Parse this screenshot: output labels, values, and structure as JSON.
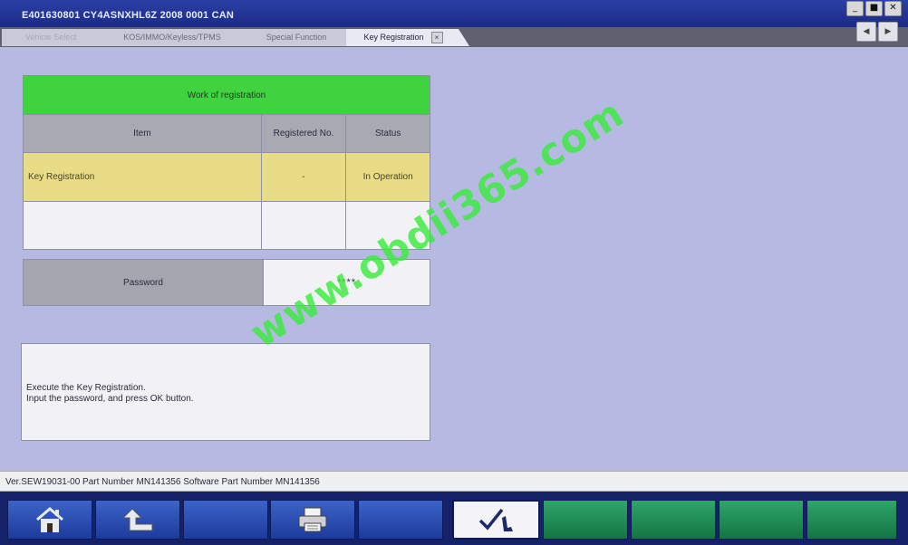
{
  "window": {
    "title": "E401630801   CY4ASNXHL6Z 2008   0001 CAN",
    "controls": [
      "_",
      "■",
      "✕"
    ]
  },
  "tabs": [
    {
      "label": "Vehicle Select",
      "state": "faded"
    },
    {
      "label": "KOS/IMMO/Keyless/TPMS",
      "state": "inactive"
    },
    {
      "label": "Special Function",
      "state": "inactive"
    },
    {
      "label": "Key Registration",
      "state": "active",
      "closable": true
    }
  ],
  "tab_nav": {
    "prev": "◀",
    "next": "▶"
  },
  "registration_table": {
    "banner": "Work of registration",
    "headers": [
      "Item",
      "Registered No.",
      "Status"
    ],
    "rows": [
      {
        "item": "Key Registration",
        "registered_no": "-",
        "status": "In Operation"
      },
      {
        "item": "",
        "registered_no": "",
        "status": ""
      }
    ]
  },
  "password": {
    "label": "Password",
    "value": "****"
  },
  "message": {
    "lines": [
      "Execute the Key Registration.",
      "Input the password, and press OK button."
    ]
  },
  "watermark": "www.obdii365.com",
  "status_bar": {
    "text": "Ver.SEW19031-00 Part Number MN141356   Software Part Number MN141356"
  },
  "toolbar": {
    "buttons": [
      {
        "icon": "home-icon",
        "enabled": true
      },
      {
        "icon": "back-arrow-icon",
        "enabled": true
      },
      {
        "icon": "",
        "enabled": false
      },
      {
        "icon": "printer-icon",
        "enabled": true
      },
      {
        "icon": "",
        "enabled": false
      },
      {
        "icon": "ok-check-icon",
        "enabled": true
      },
      {
        "icon": "",
        "enabled": false
      },
      {
        "icon": "",
        "enabled": false
      },
      {
        "icon": "",
        "enabled": false
      },
      {
        "icon": "",
        "enabled": false
      }
    ]
  },
  "colors": {
    "banner": "#3fd33f",
    "active_row": "#e8dd86",
    "background": "#b6b9e2",
    "title_bar": "#1b2a86",
    "toolbar_blue": "#2a4db0",
    "toolbar_green": "#1f8a55"
  }
}
